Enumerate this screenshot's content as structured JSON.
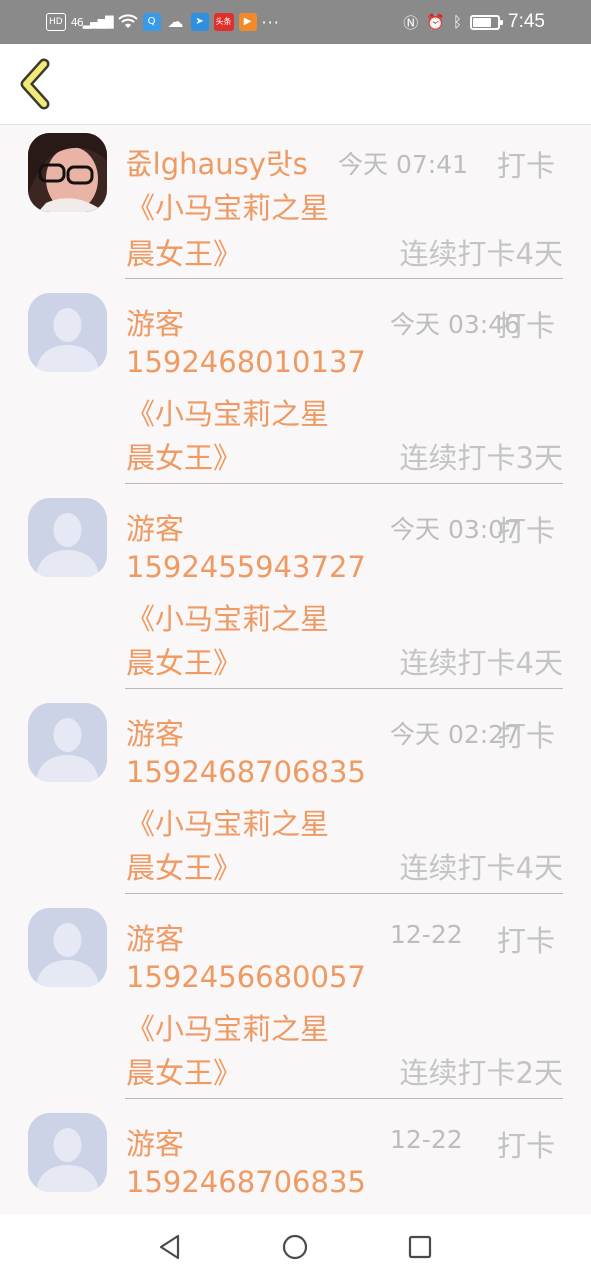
{
  "status_bar": {
    "left_chips": [
      "HD",
      "46",
      "Q",
      "头条"
    ],
    "time": "7:45",
    "icons": [
      "hd-icon",
      "signal-icon",
      "wifi-icon",
      "app-qq-icon",
      "cloud-icon",
      "telegram-icon",
      "toutiao-icon",
      "video-icon",
      "more-icon",
      "nfc-icon",
      "alarm-icon",
      "bluetooth-icon",
      "battery-icon"
    ]
  },
  "header": {
    "back_icon": "chevron-left-icon"
  },
  "items": [
    {
      "name": "줎lghausy랏s",
      "time": "今天 07:41",
      "action": "打卡",
      "phone": "",
      "book_line1": "《小马宝莉之星",
      "book_line2": "晨女王》",
      "streak": "连续打卡4天",
      "avatar": "photo"
    },
    {
      "name": "游客",
      "time": "今天 03:46",
      "action": "打卡",
      "phone": "1592468010137",
      "book_line1": "《小马宝莉之星",
      "book_line2": "晨女王》",
      "streak": "连续打卡3天",
      "avatar": "default"
    },
    {
      "name": "游客",
      "time": "今天 03:07",
      "action": "打卡",
      "phone": "1592455943727",
      "book_line1": "《小马宝莉之星",
      "book_line2": "晨女王》",
      "streak": "连续打卡4天",
      "avatar": "default"
    },
    {
      "name": "游客",
      "time": "今天 02:27",
      "action": "打卡",
      "phone": "1592468706835",
      "book_line1": "《小马宝莉之星",
      "book_line2": "晨女王》",
      "streak": "连续打卡4天",
      "avatar": "default"
    },
    {
      "name": "游客",
      "time": "12-22",
      "action": "打卡",
      "phone": "1592456680057",
      "book_line1": "《小马宝莉之星",
      "book_line2": "晨女王》",
      "streak": "连续打卡2天",
      "avatar": "default"
    },
    {
      "name": "游客",
      "time": "12-22",
      "action": "打卡",
      "phone": "1592468706835",
      "book_line1": "",
      "book_line2": "",
      "streak": "",
      "avatar": "default"
    }
  ],
  "nav_bar": {
    "icons": [
      "back-triangle-icon",
      "home-circle-icon",
      "recents-square-icon"
    ]
  },
  "colors": {
    "accent": "#ee9a62",
    "muted": "#c2c2c2",
    "status_bar": "#8a8a8a",
    "background": "#f9f7f8"
  }
}
